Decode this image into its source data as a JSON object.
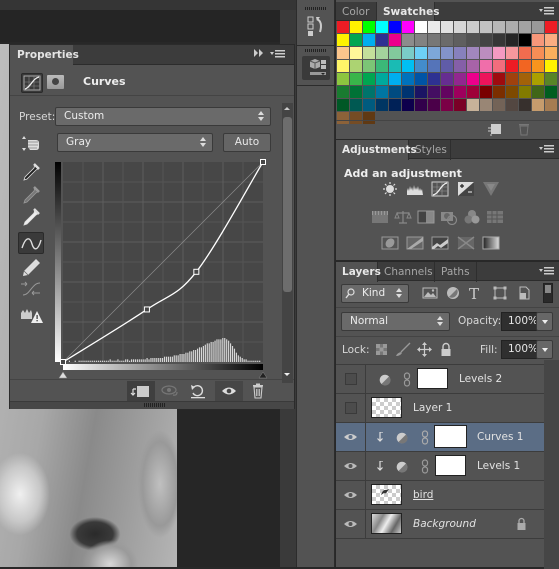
{
  "canvas": {
    "image_description": "grayscale photo of stone sculpture"
  },
  "properties": {
    "tab_label": "Properties",
    "title": "Curves",
    "preset_label": "Preset:",
    "preset_value": "Custom",
    "channel_value": "Gray",
    "auto_label": "Auto",
    "curve_points": [
      [
        0,
        0
      ],
      [
        107,
        67
      ],
      [
        170,
        115
      ],
      [
        255,
        255
      ]
    ],
    "histogram": [
      1,
      1,
      0,
      1,
      0,
      0,
      1,
      0,
      1,
      1,
      1,
      1,
      1,
      1,
      1,
      1,
      1,
      1,
      1,
      1,
      1,
      1,
      1,
      1,
      2,
      1,
      1,
      1,
      2,
      1,
      1,
      1,
      2,
      2,
      1,
      2,
      2,
      2,
      2,
      2,
      2,
      2,
      2,
      3,
      2,
      3,
      3,
      3,
      3,
      3,
      3,
      3,
      4,
      4,
      4,
      4,
      4,
      5,
      5,
      5,
      6,
      6,
      6,
      7,
      7,
      8,
      8,
      9,
      9,
      10,
      11,
      11,
      12,
      13,
      14,
      14,
      15,
      15,
      16,
      17,
      17,
      17,
      18,
      18,
      17,
      16,
      14,
      12,
      10,
      7,
      5,
      4,
      3,
      2,
      2,
      1,
      1,
      1,
      1,
      1,
      1,
      1,
      0
    ]
  },
  "swatches": {
    "tabs": [
      {
        "label": "Color",
        "active": false
      },
      {
        "label": "Swatches",
        "active": true
      }
    ],
    "colors": [
      [
        "#ed1c24",
        "#fff200",
        "#00ff00",
        "#00ffff",
        "#0000ff",
        "#ff00ff",
        "#ffffff",
        "#ebebeb",
        "#e0e0e0",
        "#d6d6d6",
        "#cccccc",
        "#c2c2c2",
        "#b7b7b7",
        "#adadad",
        "#a3a3a3",
        "#989898",
        "#ed1c24"
      ],
      [
        "#fff200",
        "#00a651",
        "#00aeef",
        "#2e3192",
        "#ec008c",
        "#8c8c8c",
        "#828282",
        "#777777",
        "#6b6b6b",
        "#5f5f5f",
        "#525252",
        "#444444",
        "#363636",
        "#262626",
        "#000000",
        "#f7977a",
        "#fbad82"
      ],
      [
        "#fdc68c",
        "#fff799",
        "#c4df9b",
        "#a3d39c",
        "#82ca9c",
        "#7accc8",
        "#6dcff6",
        "#7da7d9",
        "#8393ca",
        "#8781bd",
        "#a187be",
        "#bc8dbf",
        "#f49ac2",
        "#f6989d",
        "#f26c4f",
        "#f68e56",
        "#fbaf5d"
      ],
      [
        "#fff568",
        "#acd372",
        "#7cc576",
        "#3bb878",
        "#1abbb4",
        "#00bff3",
        "#438ccb",
        "#5574b9",
        "#605ca8",
        "#855fa8",
        "#a763a8",
        "#f06eaa",
        "#f26d7d",
        "#ed1c24",
        "#f26522",
        "#f7941d",
        "#fff200"
      ],
      [
        "#8dc63f",
        "#39b54a",
        "#00a651",
        "#00a99d",
        "#00aeef",
        "#0072bc",
        "#0054a6",
        "#2e3192",
        "#662d91",
        "#92278f",
        "#ec008c",
        "#ed145b",
        "#9e0b0f",
        "#a0410d",
        "#a36209",
        "#aba000",
        "#598527"
      ],
      [
        "#197b30",
        "#007236",
        "#00746b",
        "#0076a3",
        "#004b80",
        "#003471",
        "#1b1464",
        "#440e62",
        "#630460",
        "#9e005d",
        "#9e0039",
        "#790000",
        "#7b2e00",
        "#7d4900",
        "#827b00",
        "#406618",
        "#005e20"
      ],
      [
        "#005826",
        "#005952",
        "#005b7f",
        "#003663",
        "#002157",
        "#0d004c",
        "#32004b",
        "#4b0049",
        "#7b0046",
        "#7a0026",
        "#c7b299",
        "#998675",
        "#736357",
        "#534741",
        "#37302d",
        "#c69c6d",
        "#a67c52"
      ],
      [
        "#8c6239",
        "#754c24",
        "#603913"
      ]
    ]
  },
  "adjustments": {
    "tabs": [
      {
        "label": "Adjustments",
        "active": true
      },
      {
        "label": "Styles",
        "active": false
      }
    ],
    "heading": "Add an adjustment",
    "icons_row1": [
      "brightness-contrast-icon",
      "levels-icon",
      "curves-icon",
      "exposure-icon",
      "vibrance-icon"
    ],
    "icons_row2": [
      "hue-saturation-icon",
      "color-balance-icon",
      "black-white-icon",
      "photo-filter-icon",
      "channel-mixer-icon",
      "color-lookup-icon"
    ],
    "icons_row3": [
      "invert-icon",
      "posterize-icon",
      "threshold-icon",
      "selective-color-icon",
      "gradient-map-icon"
    ]
  },
  "layers": {
    "tabs": [
      {
        "label": "Layers",
        "active": true
      },
      {
        "label": "Channels",
        "active": false
      },
      {
        "label": "Paths",
        "active": false
      }
    ],
    "filter_value": "Kind",
    "blend_mode": "Normal",
    "opacity_label": "Opacity:",
    "opacity_value": "100%",
    "lock_label": "Lock:",
    "fill_label": "Fill:",
    "fill_value": "100%",
    "items": [
      {
        "name": "Levels 2",
        "visible": false,
        "type": "adjustment",
        "clipped": false,
        "selected": false
      },
      {
        "name": "Layer 1",
        "visible": false,
        "type": "pixel",
        "clipped": false,
        "selected": false
      },
      {
        "name": "Curves 1",
        "visible": true,
        "type": "adjustment",
        "clipped": true,
        "selected": true
      },
      {
        "name": "Levels 1",
        "visible": true,
        "type": "adjustment",
        "clipped": true,
        "selected": false
      },
      {
        "name": "bird",
        "visible": true,
        "type": "smart",
        "clipped": false,
        "selected": false
      },
      {
        "name": "Background",
        "visible": true,
        "type": "background",
        "locked": true,
        "selected": false
      }
    ]
  },
  "colors": {
    "panel_bg": "#535353",
    "selected_row": "#5b6d85",
    "tabbar_bg": "#3c3c3c"
  }
}
